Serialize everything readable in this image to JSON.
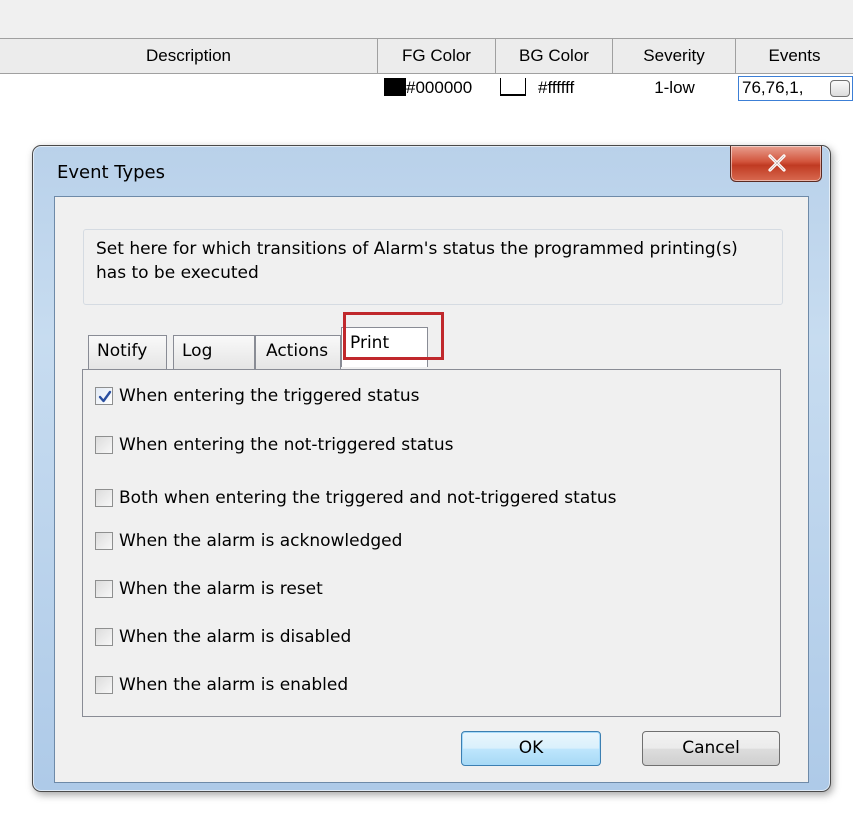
{
  "grid": {
    "columns": [
      "Description",
      "FG Color",
      "BG Color",
      "Severity",
      "Events"
    ],
    "row": {
      "description": "",
      "fg_color": "#000000",
      "bg_color": "#ffffff",
      "severity": "1-low",
      "events": "76,76,1,"
    }
  },
  "dialog": {
    "title": "Event Types",
    "info_text": "Set here for which transitions of Alarm's status the programmed printing(s) has to be executed",
    "tabs": [
      {
        "label": "Notify",
        "active": false
      },
      {
        "label": "Log",
        "active": false
      },
      {
        "label": "Actions",
        "active": false
      },
      {
        "label": "Print",
        "active": true
      }
    ],
    "options": [
      {
        "label": "When entering the triggered status",
        "checked": true
      },
      {
        "label": "When entering the not-triggered status",
        "checked": false
      },
      {
        "label": "Both when entering the triggered and not-triggered status",
        "checked": false
      },
      {
        "label": "When the alarm is acknowledged",
        "checked": false
      },
      {
        "label": "When the alarm is reset",
        "checked": false
      },
      {
        "label": "When the alarm is disabled",
        "checked": false
      },
      {
        "label": "When the alarm is enabled",
        "checked": false
      }
    ],
    "ok_label": "OK",
    "cancel_label": "Cancel"
  },
  "colors": {
    "highlight": "#c0282c",
    "close_button": "#c03a22",
    "default_button": "#3c7fb1"
  },
  "icons": {
    "close": "close-x-icon",
    "check": "checkmark-icon",
    "ellipsis": "ellipsis-button-icon"
  }
}
